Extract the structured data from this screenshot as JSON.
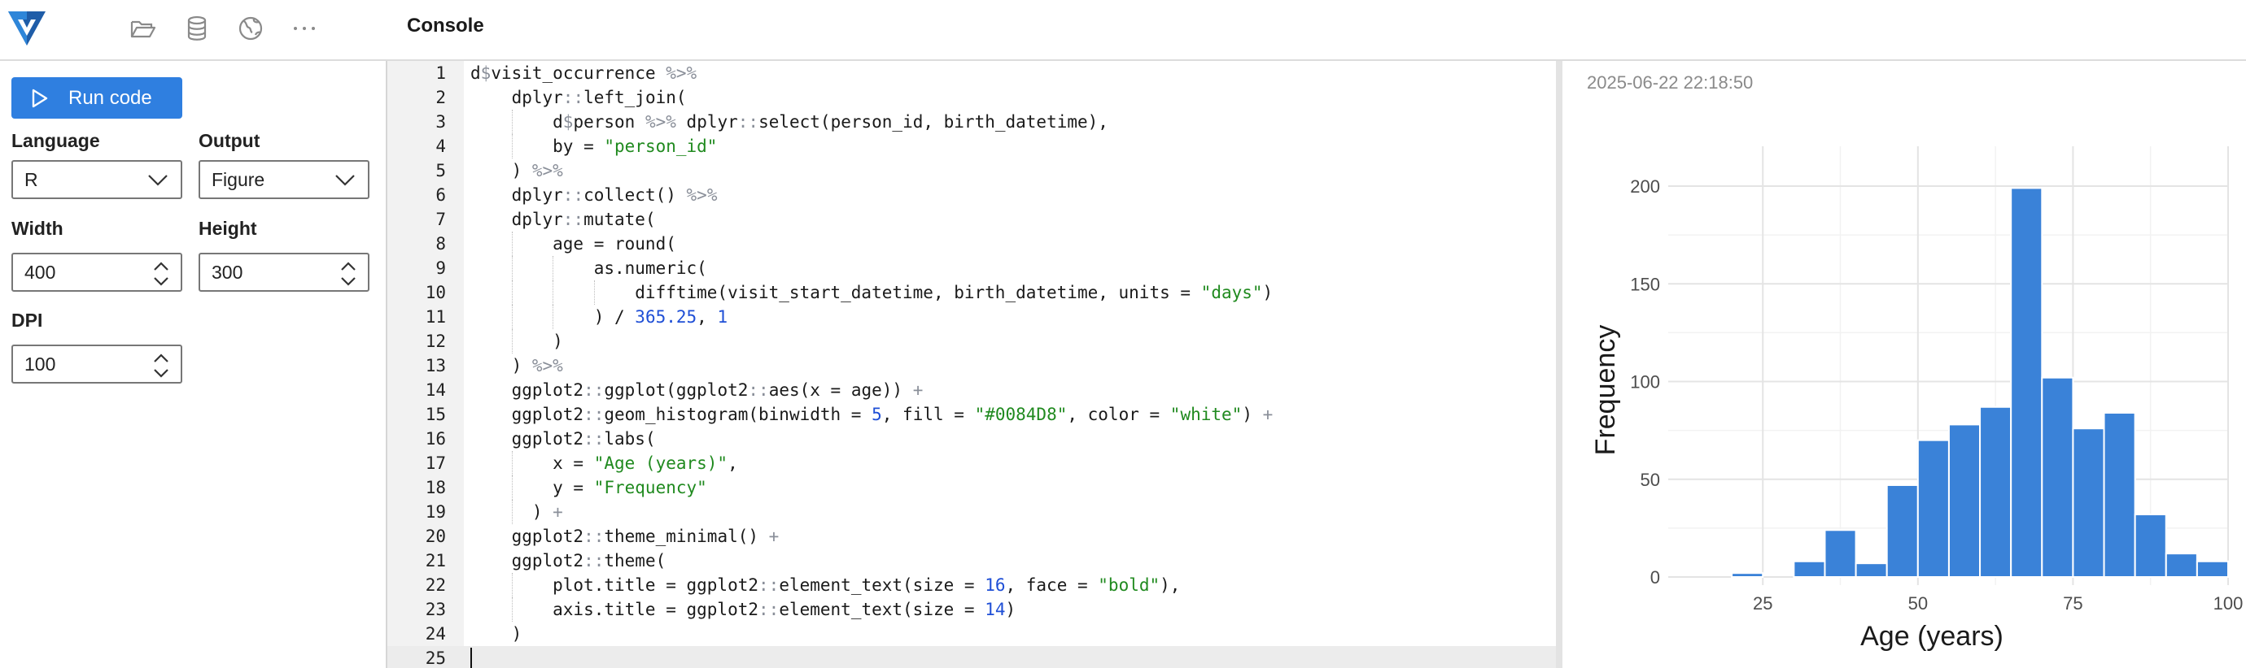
{
  "header": {
    "title": "Console"
  },
  "left": {
    "run_label": "Run code",
    "language_label": "Language",
    "language_value": "R",
    "output_label": "Output",
    "output_value": "Figure",
    "width_label": "Width",
    "width_value": "400",
    "height_label": "Height",
    "height_value": "300",
    "dpi_label": "DPI",
    "dpi_value": "100"
  },
  "editor": {
    "lines": [
      "d$visit_occurrence %>%",
      "    dplyr::left_join(",
      "        d$person %>% dplyr::select(person_id, birth_datetime),",
      "        by = \"person_id\"",
      "    ) %>%",
      "    dplyr::collect() %>%",
      "    dplyr::mutate(",
      "        age = round(",
      "            as.numeric(",
      "                difftime(visit_start_datetime, birth_datetime, units = \"days\")",
      "            ) / 365.25, 1",
      "        )",
      "    ) %>%",
      "    ggplot2::ggplot(ggplot2::aes(x = age)) +",
      "    ggplot2::geom_histogram(binwidth = 5, fill = \"#0084D8\", color = \"white\") +",
      "    ggplot2::labs(",
      "        x = \"Age (years)\",",
      "        y = \"Frequency\"",
      "      ) +",
      "    ggplot2::theme_minimal() +",
      "    ggplot2::theme(",
      "        plot.title = ggplot2::element_text(size = 16, face = \"bold\"),",
      "        axis.title = ggplot2::element_text(size = 14)",
      "    )",
      ""
    ]
  },
  "output": {
    "timestamp": "2025-06-22 22:18:50"
  },
  "chart_data": {
    "type": "bar",
    "xlabel": "Age (years)",
    "ylabel": "Frequency",
    "x_ticks": [
      25,
      50,
      75,
      100
    ],
    "y_ticks": [
      0,
      50,
      100,
      150,
      200
    ],
    "xlim": [
      15,
      100
    ],
    "ylim": [
      0,
      200
    ],
    "bin_width": 5,
    "bin_centers": [
      22.5,
      27.5,
      32.5,
      37.5,
      42.5,
      47.5,
      52.5,
      57.5,
      62.5,
      67.5,
      72.5,
      77.5,
      82.5,
      87.5,
      92.5,
      97.5
    ],
    "values": [
      2,
      0,
      8,
      24,
      7,
      47,
      70,
      78,
      87,
      199,
      102,
      76,
      84,
      32,
      12,
      8
    ],
    "fill": "#3a82d8",
    "grid": true
  }
}
